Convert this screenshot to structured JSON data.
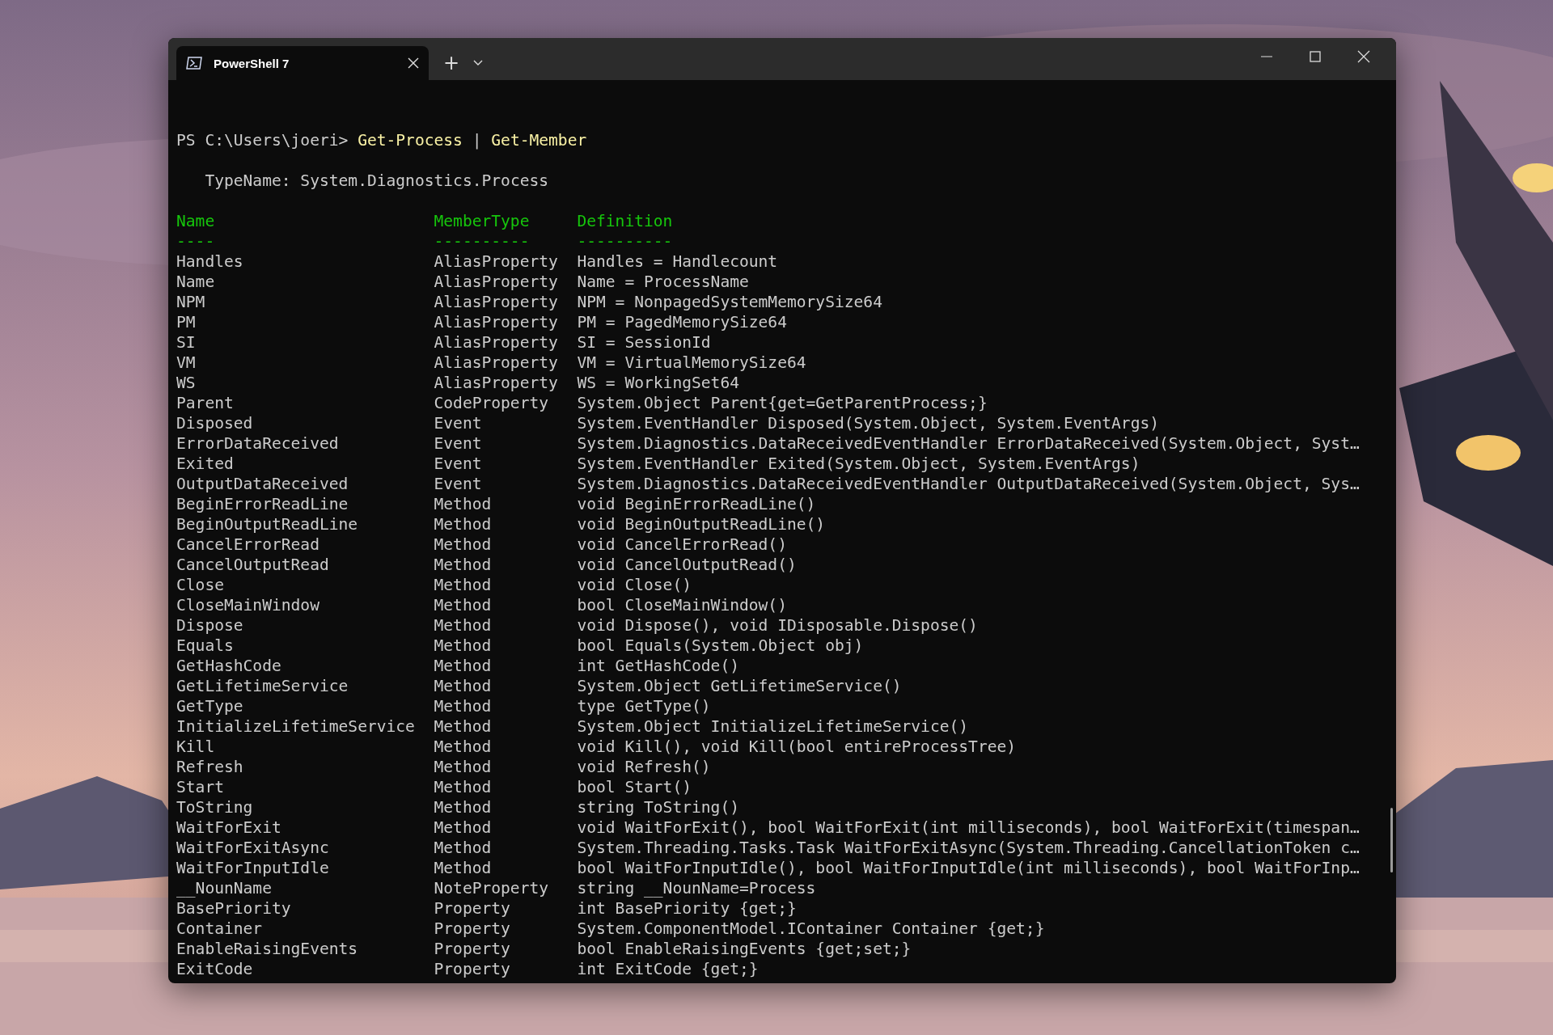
{
  "window": {
    "tabs": [
      {
        "title": "PowerShell 7",
        "selected": true
      }
    ],
    "new_tab": "+"
  },
  "terminal": {
    "prompt": "PS C:\\Users\\joeri>",
    "command": [
      {
        "kind": "cmdlet",
        "text": "Get-Process"
      },
      {
        "kind": "operator",
        "text": "|"
      },
      {
        "kind": "cmdlet",
        "text": "Get-Member"
      }
    ],
    "type_name": "TypeName: System.Diagnostics.Process",
    "columns": [
      {
        "label": "Name",
        "underline": "----"
      },
      {
        "label": "MemberType",
        "underline": "----------"
      },
      {
        "label": "Definition",
        "underline": "----------"
      }
    ],
    "rows": [
      {
        "name": "Handles",
        "member_type": "AliasProperty",
        "definition": "Handles = Handlecount"
      },
      {
        "name": "Name",
        "member_type": "AliasProperty",
        "definition": "Name = ProcessName"
      },
      {
        "name": "NPM",
        "member_type": "AliasProperty",
        "definition": "NPM = NonpagedSystemMemorySize64"
      },
      {
        "name": "PM",
        "member_type": "AliasProperty",
        "definition": "PM = PagedMemorySize64"
      },
      {
        "name": "SI",
        "member_type": "AliasProperty",
        "definition": "SI = SessionId"
      },
      {
        "name": "VM",
        "member_type": "AliasProperty",
        "definition": "VM = VirtualMemorySize64"
      },
      {
        "name": "WS",
        "member_type": "AliasProperty",
        "definition": "WS = WorkingSet64"
      },
      {
        "name": "Parent",
        "member_type": "CodeProperty",
        "definition": "System.Object Parent{get=GetParentProcess;}"
      },
      {
        "name": "Disposed",
        "member_type": "Event",
        "definition": "System.EventHandler Disposed(System.Object, System.EventArgs)"
      },
      {
        "name": "ErrorDataReceived",
        "member_type": "Event",
        "definition": "System.Diagnostics.DataReceivedEventHandler ErrorDataReceived(System.Object, Syst…"
      },
      {
        "name": "Exited",
        "member_type": "Event",
        "definition": "System.EventHandler Exited(System.Object, System.EventArgs)"
      },
      {
        "name": "OutputDataReceived",
        "member_type": "Event",
        "definition": "System.Diagnostics.DataReceivedEventHandler OutputDataReceived(System.Object, Sys…"
      },
      {
        "name": "BeginErrorReadLine",
        "member_type": "Method",
        "definition": "void BeginErrorReadLine()"
      },
      {
        "name": "BeginOutputReadLine",
        "member_type": "Method",
        "definition": "void BeginOutputReadLine()"
      },
      {
        "name": "CancelErrorRead",
        "member_type": "Method",
        "definition": "void CancelErrorRead()"
      },
      {
        "name": "CancelOutputRead",
        "member_type": "Method",
        "definition": "void CancelOutputRead()"
      },
      {
        "name": "Close",
        "member_type": "Method",
        "definition": "void Close()"
      },
      {
        "name": "CloseMainWindow",
        "member_type": "Method",
        "definition": "bool CloseMainWindow()"
      },
      {
        "name": "Dispose",
        "member_type": "Method",
        "definition": "void Dispose(), void IDisposable.Dispose()"
      },
      {
        "name": "Equals",
        "member_type": "Method",
        "definition": "bool Equals(System.Object obj)"
      },
      {
        "name": "GetHashCode",
        "member_type": "Method",
        "definition": "int GetHashCode()"
      },
      {
        "name": "GetLifetimeService",
        "member_type": "Method",
        "definition": "System.Object GetLifetimeService()"
      },
      {
        "name": "GetType",
        "member_type": "Method",
        "definition": "type GetType()"
      },
      {
        "name": "InitializeLifetimeService",
        "member_type": "Method",
        "definition": "System.Object InitializeLifetimeService()"
      },
      {
        "name": "Kill",
        "member_type": "Method",
        "definition": "void Kill(), void Kill(bool entireProcessTree)"
      },
      {
        "name": "Refresh",
        "member_type": "Method",
        "definition": "void Refresh()"
      },
      {
        "name": "Start",
        "member_type": "Method",
        "definition": "bool Start()"
      },
      {
        "name": "ToString",
        "member_type": "Method",
        "definition": "string ToString()"
      },
      {
        "name": "WaitForExit",
        "member_type": "Method",
        "definition": "void WaitForExit(), bool WaitForExit(int milliseconds), bool WaitForExit(timespan…"
      },
      {
        "name": "WaitForExitAsync",
        "member_type": "Method",
        "definition": "System.Threading.Tasks.Task WaitForExitAsync(System.Threading.CancellationToken c…"
      },
      {
        "name": "WaitForInputIdle",
        "member_type": "Method",
        "definition": "bool WaitForInputIdle(), bool WaitForInputIdle(int milliseconds), bool WaitForInp…"
      },
      {
        "name": "__NounName",
        "member_type": "NoteProperty",
        "definition": "string __NounName=Process"
      },
      {
        "name": "BasePriority",
        "member_type": "Property",
        "definition": "int BasePriority {get;}"
      },
      {
        "name": "Container",
        "member_type": "Property",
        "definition": "System.ComponentModel.IContainer Container {get;}"
      },
      {
        "name": "EnableRaisingEvents",
        "member_type": "Property",
        "definition": "bool EnableRaisingEvents {get;set;}"
      },
      {
        "name": "ExitCode",
        "member_type": "Property",
        "definition": "int ExitCode {get;}"
      }
    ]
  }
}
